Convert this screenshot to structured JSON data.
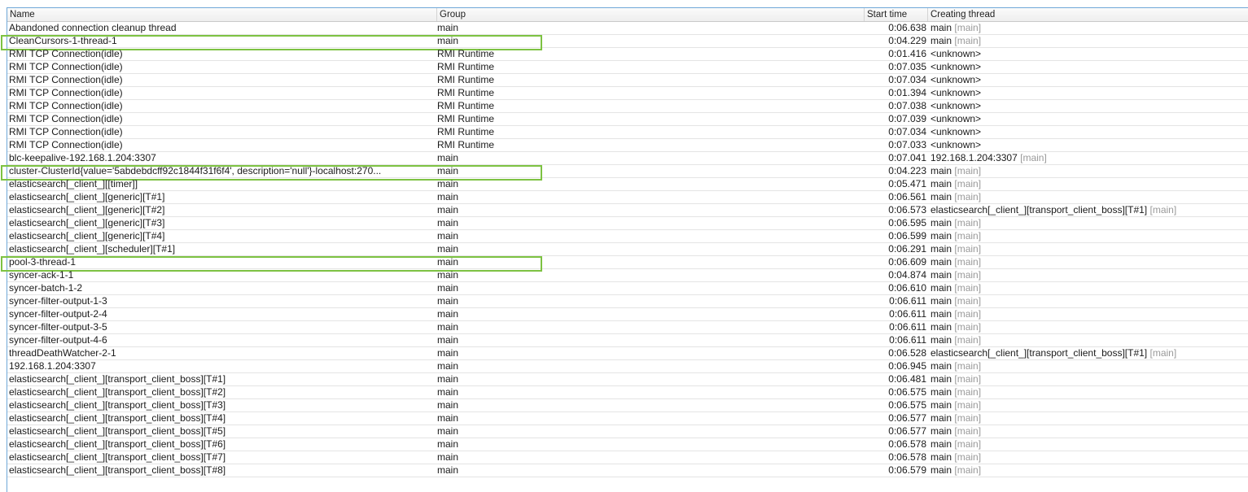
{
  "columns": {
    "name": "Name",
    "group": "Group",
    "start": "Start time",
    "creator": "Creating thread"
  },
  "rows": [
    {
      "name": "Abandoned connection cleanup thread",
      "group": "main",
      "start": "0:06.638",
      "creator": "main",
      "creator_group": "[main]",
      "highlighted": false
    },
    {
      "name": "CleanCursors-1-thread-1",
      "group": "main",
      "start": "0:04.229",
      "creator": "main",
      "creator_group": "[main]",
      "highlighted": true
    },
    {
      "name": "RMI TCP Connection(idle)",
      "group": "RMI Runtime",
      "start": "0:01.416",
      "creator": "<unknown>",
      "creator_group": "",
      "highlighted": false
    },
    {
      "name": "RMI TCP Connection(idle)",
      "group": "RMI Runtime",
      "start": "0:07.035",
      "creator": "<unknown>",
      "creator_group": "",
      "highlighted": false
    },
    {
      "name": "RMI TCP Connection(idle)",
      "group": "RMI Runtime",
      "start": "0:07.034",
      "creator": "<unknown>",
      "creator_group": "",
      "highlighted": false
    },
    {
      "name": "RMI TCP Connection(idle)",
      "group": "RMI Runtime",
      "start": "0:01.394",
      "creator": "<unknown>",
      "creator_group": "",
      "highlighted": false
    },
    {
      "name": "RMI TCP Connection(idle)",
      "group": "RMI Runtime",
      "start": "0:07.038",
      "creator": "<unknown>",
      "creator_group": "",
      "highlighted": false
    },
    {
      "name": "RMI TCP Connection(idle)",
      "group": "RMI Runtime",
      "start": "0:07.039",
      "creator": "<unknown>",
      "creator_group": "",
      "highlighted": false
    },
    {
      "name": "RMI TCP Connection(idle)",
      "group": "RMI Runtime",
      "start": "0:07.034",
      "creator": "<unknown>",
      "creator_group": "",
      "highlighted": false
    },
    {
      "name": "RMI TCP Connection(idle)",
      "group": "RMI Runtime",
      "start": "0:07.033",
      "creator": "<unknown>",
      "creator_group": "",
      "highlighted": false
    },
    {
      "name": "blc-keepalive-192.168.1.204:3307",
      "group": "main",
      "start": "0:07.041",
      "creator": "192.168.1.204:3307",
      "creator_group": "[main]",
      "highlighted": false
    },
    {
      "name": "cluster-ClusterId{value='5abdebdcff92c1844f31f6f4', description='null'}-localhost:270...",
      "group": "main",
      "start": "0:04.223",
      "creator": "main",
      "creator_group": "[main]",
      "highlighted": true
    },
    {
      "name": "elasticsearch[_client_][[timer]]",
      "group": "main",
      "start": "0:05.471",
      "creator": "main",
      "creator_group": "[main]",
      "highlighted": false
    },
    {
      "name": "elasticsearch[_client_][generic][T#1]",
      "group": "main",
      "start": "0:06.561",
      "creator": "main",
      "creator_group": "[main]",
      "highlighted": false
    },
    {
      "name": "elasticsearch[_client_][generic][T#2]",
      "group": "main",
      "start": "0:06.573",
      "creator": "elasticsearch[_client_][transport_client_boss][T#1]",
      "creator_group": "[main]",
      "highlighted": false
    },
    {
      "name": "elasticsearch[_client_][generic][T#3]",
      "group": "main",
      "start": "0:06.595",
      "creator": "main",
      "creator_group": "[main]",
      "highlighted": false
    },
    {
      "name": "elasticsearch[_client_][generic][T#4]",
      "group": "main",
      "start": "0:06.599",
      "creator": "main",
      "creator_group": "[main]",
      "highlighted": false
    },
    {
      "name": "elasticsearch[_client_][scheduler][T#1]",
      "group": "main",
      "start": "0:06.291",
      "creator": "main",
      "creator_group": "[main]",
      "highlighted": false
    },
    {
      "name": "pool-3-thread-1",
      "group": "main",
      "start": "0:06.609",
      "creator": "main",
      "creator_group": "[main]",
      "highlighted": true
    },
    {
      "name": "syncer-ack-1-1",
      "group": "main",
      "start": "0:04.874",
      "creator": "main",
      "creator_group": "[main]",
      "highlighted": false
    },
    {
      "name": "syncer-batch-1-2",
      "group": "main",
      "start": "0:06.610",
      "creator": "main",
      "creator_group": "[main]",
      "highlighted": false
    },
    {
      "name": "syncer-filter-output-1-3",
      "group": "main",
      "start": "0:06.611",
      "creator": "main",
      "creator_group": "[main]",
      "highlighted": false
    },
    {
      "name": "syncer-filter-output-2-4",
      "group": "main",
      "start": "0:06.611",
      "creator": "main",
      "creator_group": "[main]",
      "highlighted": false
    },
    {
      "name": "syncer-filter-output-3-5",
      "group": "main",
      "start": "0:06.611",
      "creator": "main",
      "creator_group": "[main]",
      "highlighted": false
    },
    {
      "name": "syncer-filter-output-4-6",
      "group": "main",
      "start": "0:06.611",
      "creator": "main",
      "creator_group": "[main]",
      "highlighted": false
    },
    {
      "name": "threadDeathWatcher-2-1",
      "group": "main",
      "start": "0:06.528",
      "creator": "elasticsearch[_client_][transport_client_boss][T#1]",
      "creator_group": "[main]",
      "highlighted": false
    },
    {
      "name": "192.168.1.204:3307",
      "group": "main",
      "start": "0:06.945",
      "creator": "main",
      "creator_group": "[main]",
      "highlighted": false
    },
    {
      "name": "elasticsearch[_client_][transport_client_boss][T#1]",
      "group": "main",
      "start": "0:06.481",
      "creator": "main",
      "creator_group": "[main]",
      "highlighted": false
    },
    {
      "name": "elasticsearch[_client_][transport_client_boss][T#2]",
      "group": "main",
      "start": "0:06.575",
      "creator": "main",
      "creator_group": "[main]",
      "highlighted": false
    },
    {
      "name": "elasticsearch[_client_][transport_client_boss][T#3]",
      "group": "main",
      "start": "0:06.575",
      "creator": "main",
      "creator_group": "[main]",
      "highlighted": false
    },
    {
      "name": "elasticsearch[_client_][transport_client_boss][T#4]",
      "group": "main",
      "start": "0:06.577",
      "creator": "main",
      "creator_group": "[main]",
      "highlighted": false
    },
    {
      "name": "elasticsearch[_client_][transport_client_boss][T#5]",
      "group": "main",
      "start": "0:06.577",
      "creator": "main",
      "creator_group": "[main]",
      "highlighted": false
    },
    {
      "name": "elasticsearch[_client_][transport_client_boss][T#6]",
      "group": "main",
      "start": "0:06.578",
      "creator": "main",
      "creator_group": "[main]",
      "highlighted": false
    },
    {
      "name": "elasticsearch[_client_][transport_client_boss][T#7]",
      "group": "main",
      "start": "0:06.578",
      "creator": "main",
      "creator_group": "[main]",
      "highlighted": false
    },
    {
      "name": "elasticsearch[_client_][transport_client_boss][T#8]",
      "group": "main",
      "start": "0:06.579",
      "creator": "main",
      "creator_group": "[main]",
      "highlighted": false
    }
  ],
  "colors": {
    "highlight": "#7dc242",
    "border": "#6fa8d8",
    "muted": "#9a9a9a"
  }
}
